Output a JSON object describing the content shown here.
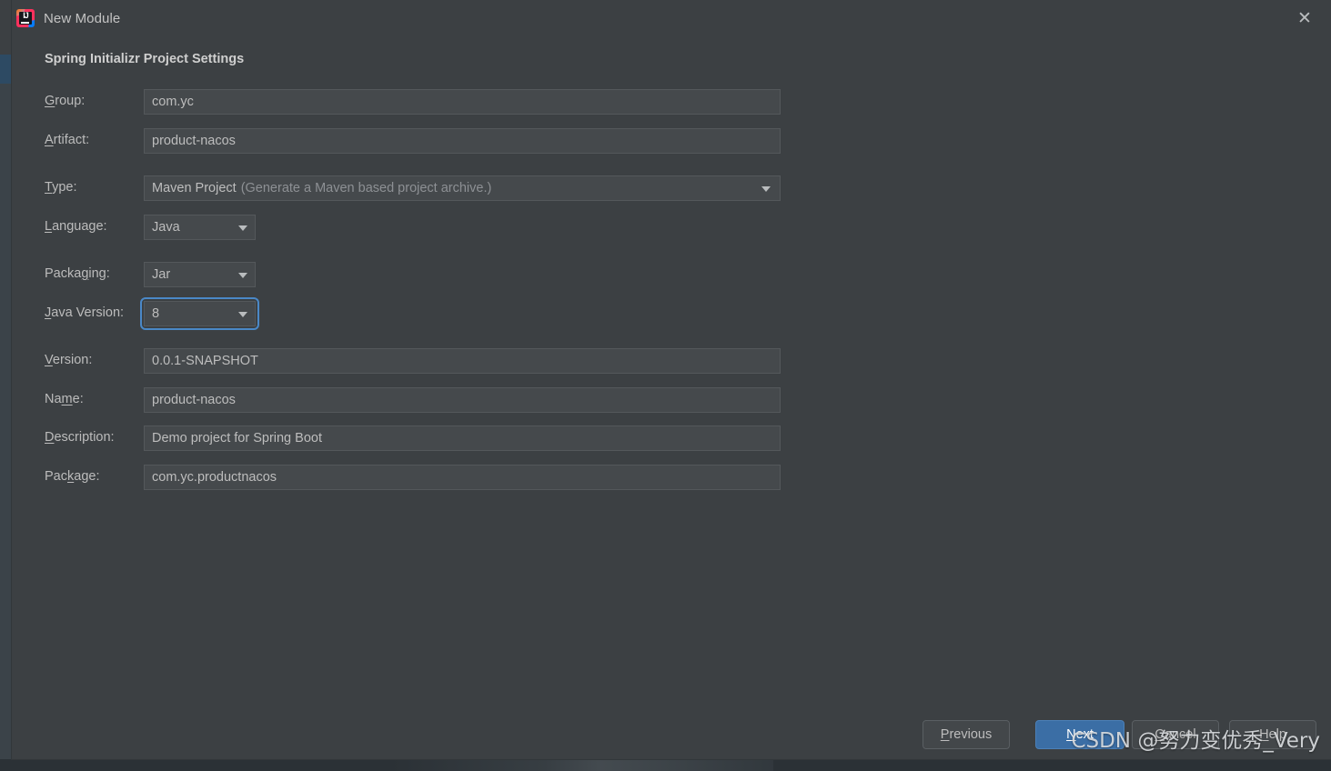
{
  "window": {
    "title": "New Module",
    "app_icon": "intellij-idea-icon",
    "icon_text": "IJ",
    "close_label": "✕"
  },
  "heading": "Spring Initializr Project Settings",
  "form": {
    "rows": [
      {
        "label_pre": "",
        "label_mn": "G",
        "label_post": "roup:",
        "value": "com.yc",
        "kind": "text"
      },
      {
        "label_pre": "",
        "label_mn": "A",
        "label_post": "rtifact:",
        "value": "product-nacos",
        "kind": "text"
      },
      {
        "label_pre": "",
        "label_mn": "T",
        "label_post": "ype:",
        "value": "Maven Project",
        "hint": "(Generate a Maven based project archive.)",
        "kind": "combo-wide"
      },
      {
        "label_pre": "",
        "label_mn": "L",
        "label_post": "anguage:",
        "value": "Java",
        "kind": "combo"
      },
      {
        "label_pre": "Packa",
        "label_mn": "g",
        "label_post": "ing:",
        "value": "Jar",
        "kind": "combo"
      },
      {
        "label_pre": "",
        "label_mn": "J",
        "label_post": "ava Version:",
        "value": "8",
        "kind": "combo",
        "focused": true
      },
      {
        "label_pre": "",
        "label_mn": "V",
        "label_post": "ersion:",
        "value": "0.0.1-SNAPSHOT",
        "kind": "text"
      },
      {
        "label_pre": "Na",
        "label_mn": "m",
        "label_post": "e:",
        "value": "product-nacos",
        "kind": "text"
      },
      {
        "label_pre": "",
        "label_mn": "D",
        "label_post": "escription:",
        "value": "Demo project for Spring Boot",
        "kind": "text"
      },
      {
        "label_pre": "Pac",
        "label_mn": "k",
        "label_post": "age:",
        "value": "com.yc.productnacos",
        "kind": "text"
      }
    ]
  },
  "buttons": {
    "previous": {
      "pre": "",
      "mn": "P",
      "post": "revious"
    },
    "next": {
      "pre": "",
      "mn": "N",
      "post": "ext"
    },
    "cancel": {
      "pre": "",
      "mn": "C",
      "post": "ancel"
    },
    "help": {
      "pre": "",
      "mn": "H",
      "post": "elp"
    }
  },
  "watermark": "CSDN @努力变优秀_Very",
  "colors": {
    "dialog_bg": "#3c4043",
    "field_bg": "#45494c",
    "focus_ring": "#4a88c7",
    "primary_button": "#3b6ea5",
    "text": "#bdbdbd",
    "hint_text": "#8d9094"
  }
}
